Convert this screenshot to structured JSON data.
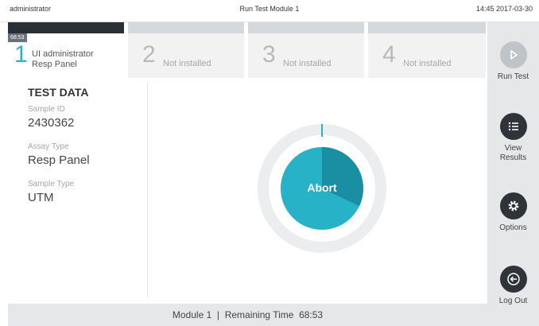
{
  "topbar": {
    "user": "administrator",
    "title": "Run Test Module 1",
    "datetime": "14:45 2017-03-30"
  },
  "tabs": [
    {
      "number": "1",
      "countdown": "68:53",
      "line1": "UI administrator",
      "line2": "Resp Panel",
      "active": true
    },
    {
      "number": "2",
      "status": "Not installed",
      "active": false
    },
    {
      "number": "3",
      "status": "Not installed",
      "active": false
    },
    {
      "number": "4",
      "status": "Not installed",
      "active": false
    }
  ],
  "test_data": {
    "heading": "TEST DATA",
    "sample_id_label": "Sample ID",
    "sample_id": "2430362",
    "assay_type_label": "Assay Type",
    "assay_type": "Resp Panel",
    "sample_type_label": "Sample Type",
    "sample_type": "UTM"
  },
  "progress": {
    "abort_label": "Abort",
    "ring_fraction": 0.0,
    "inner_fraction": 0.32
  },
  "sidebar": {
    "run_test": "Run Test",
    "view_results": "View Results",
    "options": "Options",
    "log_out": "Log Out"
  },
  "bottombar": {
    "text": "Module 1  |  Remaining Time  68:53"
  },
  "colors": {
    "accent": "#27b2c8",
    "accent_dark": "#1a8fa3",
    "dark": "#2f343a",
    "ring_bg": "#ebedee"
  }
}
